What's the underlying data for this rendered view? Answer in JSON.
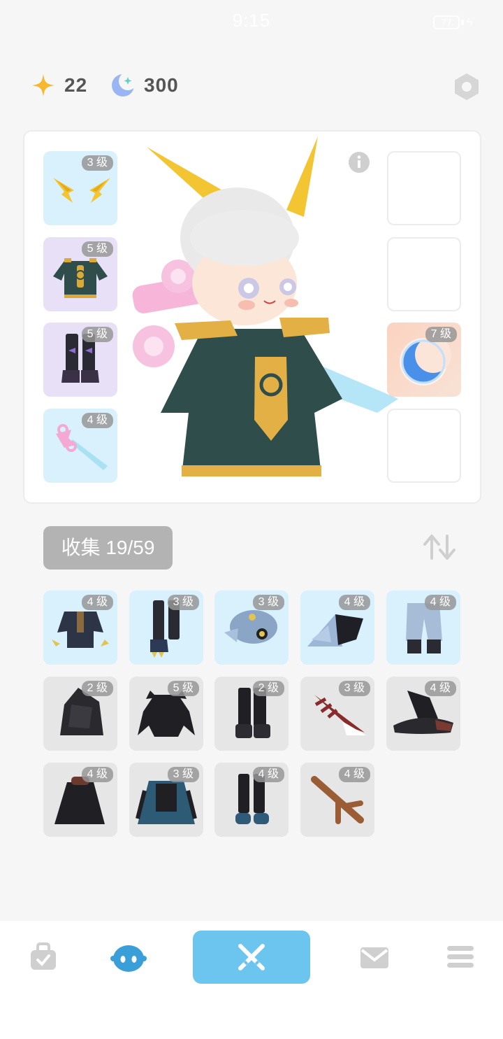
{
  "status_bar": {
    "time": "9:15",
    "battery": "77"
  },
  "currency": {
    "stars": "22",
    "moons": "300"
  },
  "equipped": {
    "left": [
      {
        "level": "3 级",
        "item": "golden-wings",
        "bg": "blue"
      },
      {
        "level": "5 级",
        "item": "teal-robe",
        "bg": "purple"
      },
      {
        "level": "5 级",
        "item": "dark-boots",
        "bg": "purple"
      },
      {
        "level": "4 级",
        "item": "pink-sword",
        "bg": "blue"
      }
    ],
    "right": [
      {
        "level": "",
        "item": "empty"
      },
      {
        "level": "",
        "item": "empty"
      },
      {
        "level": "7 级",
        "item": "blue-moon",
        "bg": "orange"
      },
      {
        "level": "",
        "item": "empty"
      }
    ]
  },
  "collection": {
    "label": "收集 19/59",
    "items": [
      {
        "level": "4 级",
        "item": "dark-cape",
        "bg": "blue"
      },
      {
        "level": "3 级",
        "item": "claw-boots",
        "bg": "blue"
      },
      {
        "level": "3 级",
        "item": "fish-helmet",
        "bg": "blue"
      },
      {
        "level": "4 级",
        "item": "ice-wing",
        "bg": "blue"
      },
      {
        "level": "4 级",
        "item": "pale-pants",
        "bg": "blue"
      },
      {
        "level": "2 级",
        "item": "dark-hood",
        "bg": "gray"
      },
      {
        "level": "5 级",
        "item": "shadow-armor",
        "bg": "gray"
      },
      {
        "level": "2 级",
        "item": "black-boots",
        "bg": "gray"
      },
      {
        "level": "3 级",
        "item": "red-blade",
        "bg": "gray"
      },
      {
        "level": "4 级",
        "item": "witch-hat",
        "bg": "gray"
      },
      {
        "level": "4 级",
        "item": "dark-cloak",
        "bg": "gray"
      },
      {
        "level": "3 级",
        "item": "teal-vest",
        "bg": "gray"
      },
      {
        "level": "4 级",
        "item": "blue-shoes",
        "bg": "gray"
      },
      {
        "level": "4 级",
        "item": "wood-branch",
        "bg": "gray"
      }
    ]
  },
  "colors": {
    "accent": "#6cc5ee",
    "star": "#f5b830",
    "moon": "#8fb3f0"
  },
  "nav": [
    "bag-icon",
    "character-icon",
    "battle-icon",
    "mail-icon",
    "menu-icon"
  ]
}
